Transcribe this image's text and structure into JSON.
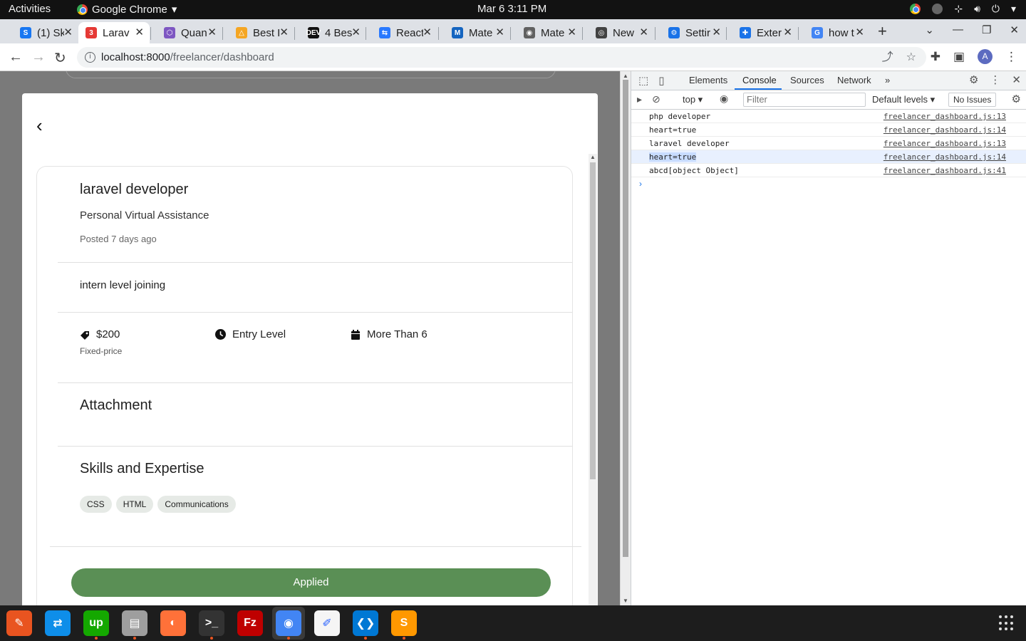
{
  "system": {
    "activities": "Activities",
    "app_name": "Google Chrome",
    "clock": "Mar 6  3:11 PM"
  },
  "tabs": [
    {
      "label": "(1) Sk",
      "color": "#1877f2",
      "glyph": "S"
    },
    {
      "label": "Larav",
      "color": "#e53935",
      "glyph": "3"
    },
    {
      "label": "Quan",
      "color": "#7e57c2",
      "glyph": "⬡"
    },
    {
      "label": "Best I",
      "color": "#f5a623",
      "glyph": "△"
    },
    {
      "label": "4 Bes",
      "color": "#111111",
      "glyph": "DEV"
    },
    {
      "label": "React",
      "color": "#2979ff",
      "glyph": "⇆"
    },
    {
      "label": "Mate",
      "color": "#1565c0",
      "glyph": "M"
    },
    {
      "label": "Mate",
      "color": "#616161",
      "glyph": "◉"
    },
    {
      "label": "New",
      "color": "#424242",
      "glyph": "◎"
    },
    {
      "label": "Settir",
      "color": "#1a73e8",
      "glyph": "⚙"
    },
    {
      "label": "Exter",
      "color": "#1a73e8",
      "glyph": "✚"
    },
    {
      "label": "how t",
      "color": "#4285f4",
      "glyph": "G"
    }
  ],
  "address_bar": {
    "host": "localhost:8000",
    "path": "/freelancer/dashboard"
  },
  "profile_initial": "A",
  "job": {
    "title": "laravel developer",
    "subtitle": "Personal Virtual Assistance",
    "posted": "Posted 7 days ago",
    "description": "intern level joining",
    "price": "$200",
    "price_type": "Fixed-price",
    "experience": "Entry Level",
    "duration": "More Than 6",
    "attachment_heading": "Attachment",
    "skills_heading": "Skills and Expertise",
    "skills": [
      "CSS",
      "HTML",
      "Communications"
    ],
    "applied_label": "Applied"
  },
  "devtools": {
    "tabs": [
      "Elements",
      "Console",
      "Sources",
      "Network"
    ],
    "context": "top ▾",
    "filter_placeholder": "Filter",
    "levels": "Default levels ▾",
    "issues": "No Issues",
    "logs": [
      {
        "msg": "php developer",
        "src": "freelancer_dashboard.js:13"
      },
      {
        "msg": "heart=true",
        "src": "freelancer_dashboard.js:14"
      },
      {
        "msg": "laravel developer",
        "src": "freelancer_dashboard.js:13"
      },
      {
        "msg": "heart=true",
        "src": "freelancer_dashboard.js:14"
      },
      {
        "msg": "abcd[object Object]",
        "src": "freelancer_dashboard.js:41"
      }
    ]
  },
  "dock": [
    {
      "name": "launcher",
      "color": "#e95420",
      "glyph": "✎",
      "running": false
    },
    {
      "name": "teamviewer",
      "color": "#0e8ee9",
      "glyph": "⇄",
      "running": false
    },
    {
      "name": "upwork",
      "color": "#14a800",
      "glyph": "up",
      "running": true
    },
    {
      "name": "files",
      "color": "#9e9e9e",
      "glyph": "▤",
      "running": true
    },
    {
      "name": "firefox",
      "color": "#ff7139",
      "glyph": "◐",
      "running": false
    },
    {
      "name": "terminal",
      "color": "#333333",
      "glyph": ">_",
      "running": true
    },
    {
      "name": "filezilla",
      "color": "#bf0000",
      "glyph": "Fz",
      "running": false
    },
    {
      "name": "chrome",
      "color": "#4285f4",
      "glyph": "◉",
      "running": true
    },
    {
      "name": "text-editor",
      "color": "#f5f5f5",
      "glyph": "✐",
      "running": false
    },
    {
      "name": "vscode",
      "color": "#0078d4",
      "glyph": "❮❯",
      "running": true
    },
    {
      "name": "sublime",
      "color": "#ff9800",
      "glyph": "S",
      "running": true
    }
  ]
}
